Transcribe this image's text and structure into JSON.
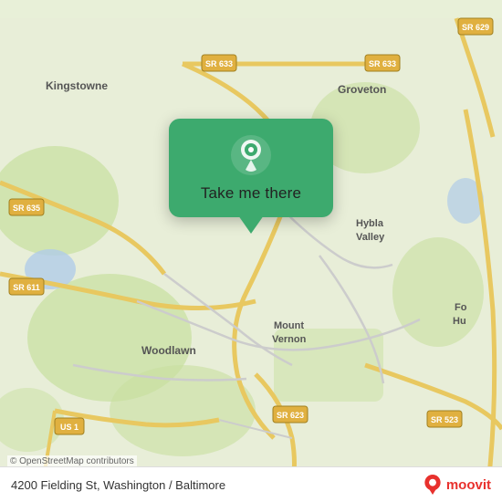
{
  "map": {
    "alt": "Map of 4200 Fielding St, Washington / Baltimore area",
    "copyright": "© OpenStreetMap contributors",
    "bg_color": "#e8f0d8"
  },
  "popup": {
    "button_label": "Take me there",
    "pin_icon": "location-pin"
  },
  "bottom_bar": {
    "address": "4200 Fielding St, Washington / Baltimore",
    "logo_text": "moovit"
  }
}
